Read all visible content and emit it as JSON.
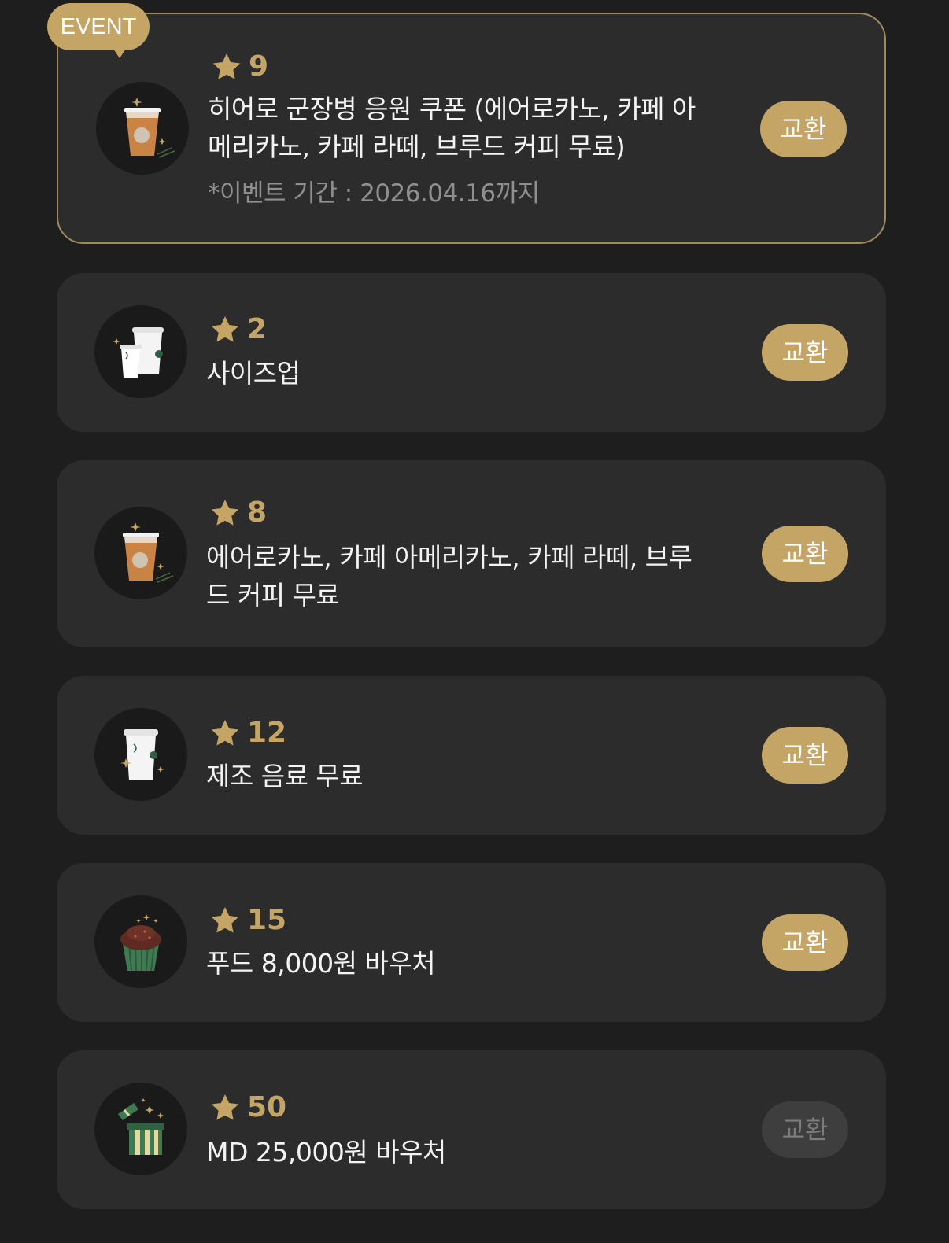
{
  "event_badge": "EVENT",
  "rewards": [
    {
      "stars": "9",
      "title": "히어로 군장병 응원 쿠폰 (에어로카노, 카페 아메리카노, 카페 라떼, 브루드 커피 무료)",
      "note": "*이벤트 기간 : 2026.04.16까지",
      "button": "교환",
      "icon": "iced-coffee-icon",
      "enabled": true
    },
    {
      "stars": "2",
      "title": "사이즈업",
      "button": "교환",
      "icon": "size-up-cups-icon",
      "enabled": true
    },
    {
      "stars": "8",
      "title": "에어로카노, 카페 아메리카노, 카페 라떼, 브루드 커피 무료",
      "button": "교환",
      "icon": "iced-coffee-icon",
      "enabled": true
    },
    {
      "stars": "12",
      "title": "제조 음료 무료",
      "button": "교환",
      "icon": "hot-cup-icon",
      "enabled": true
    },
    {
      "stars": "15",
      "title": "푸드 8,000원 바우처",
      "button": "교환",
      "icon": "cupcake-icon",
      "enabled": true
    },
    {
      "stars": "50",
      "title": "MD 25,000원 바우처",
      "button": "교환",
      "icon": "gift-box-icon",
      "enabled": false
    }
  ],
  "colors": {
    "background": "#1e1e1e",
    "card": "#2c2c2c",
    "accent_gold": "#c4a566",
    "event_border": "#a08a60",
    "disabled_button": "#3e3e3e"
  }
}
